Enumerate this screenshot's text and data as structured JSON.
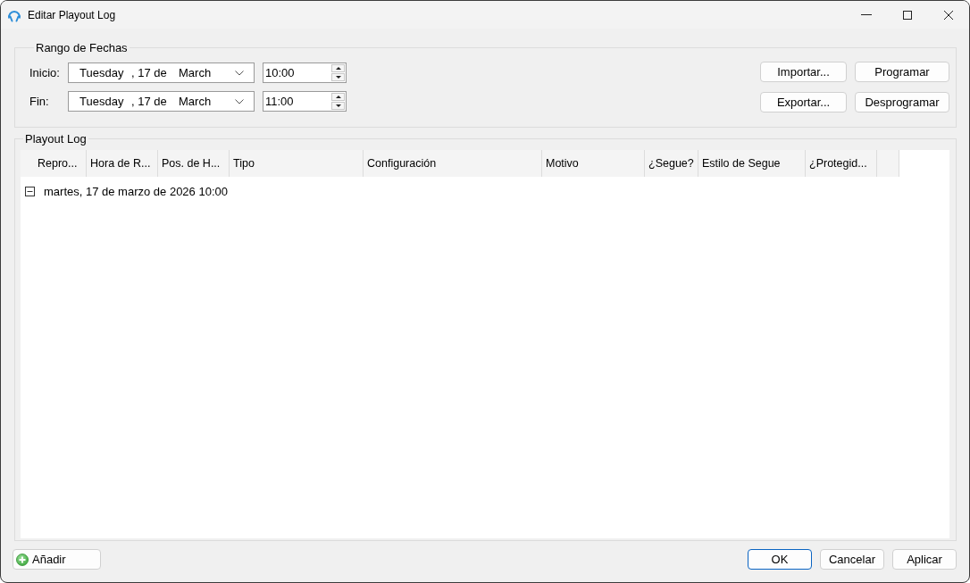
{
  "window": {
    "title": "Editar Playout Log"
  },
  "date_range": {
    "title": "Rango de Fechas",
    "rows": [
      {
        "label": "Inicio:",
        "weekday": "Tuesday",
        "day": ", 17 de",
        "month": "March",
        "time": "10:00"
      },
      {
        "label": "Fin:",
        "weekday": "Tuesday",
        "day": ", 17 de",
        "month": "March",
        "time": "11:00"
      }
    ],
    "buttons": [
      "Importar...",
      "Programar",
      "Exportar...",
      "Desprogramar"
    ]
  },
  "playout_log": {
    "title": "Playout Log",
    "columns": [
      "Repro...",
      "Hora de R...",
      "Pos. de H...",
      "Tipo",
      "Configuración",
      "Motivo",
      "¿Segue?",
      "Estilo de Segue",
      "¿Protegid..."
    ],
    "groups": [
      {
        "label": "martes, 17 de marzo de 2026 10:00",
        "expanded": true
      }
    ]
  },
  "footer": {
    "add_button": "Añadir",
    "buttons": [
      {
        "label": "OK",
        "default": true
      },
      {
        "label": "Cancelar",
        "default": false
      },
      {
        "label": "Aplicar",
        "default": false
      }
    ]
  }
}
